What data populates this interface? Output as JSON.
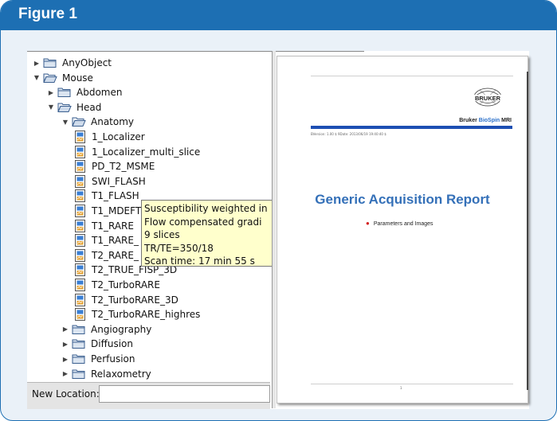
{
  "figure": {
    "title": "Figure 1",
    "accent_color": "#1d6fb3"
  },
  "tree": {
    "nodes": [
      {
        "label": "AnyObject",
        "kind": "folder",
        "expanded": false,
        "depth": 0
      },
      {
        "label": "Mouse",
        "kind": "folder",
        "expanded": true,
        "depth": 0
      },
      {
        "label": "Abdomen",
        "kind": "folder",
        "expanded": false,
        "depth": 1
      },
      {
        "label": "Head",
        "kind": "folder",
        "expanded": true,
        "depth": 1
      },
      {
        "label": "Anatomy",
        "kind": "folder",
        "expanded": true,
        "depth": 2
      },
      {
        "label": "1_Localizer",
        "kind": "file",
        "depth": 3
      },
      {
        "label": "1_Localizer_multi_slice",
        "kind": "file",
        "depth": 3
      },
      {
        "label": "PD_T2_MSME",
        "kind": "file",
        "depth": 3
      },
      {
        "label": "SWI_FLASH",
        "kind": "file",
        "depth": 3
      },
      {
        "label": "T1_FLASH",
        "kind": "file",
        "depth": 3
      },
      {
        "label": "T1_MDEFT",
        "kind": "file",
        "depth": 3
      },
      {
        "label": "T1_RARE",
        "kind": "file",
        "depth": 3
      },
      {
        "label": "T1_RARE_",
        "kind": "file",
        "depth": 3
      },
      {
        "label": "T2_RARE_",
        "kind": "file",
        "depth": 3
      },
      {
        "label": "T2_TRUE_FISP_3D",
        "kind": "file",
        "depth": 3
      },
      {
        "label": "T2_TurboRARE",
        "kind": "file",
        "depth": 3
      },
      {
        "label": "T2_TurboRARE_3D",
        "kind": "file",
        "depth": 3
      },
      {
        "label": "T2_TurboRARE_highres",
        "kind": "file",
        "depth": 3
      },
      {
        "label": "Angiography",
        "kind": "folder",
        "expanded": false,
        "depth": 2
      },
      {
        "label": "Diffusion",
        "kind": "folder",
        "expanded": false,
        "depth": 2
      },
      {
        "label": "Perfusion",
        "kind": "folder",
        "expanded": false,
        "depth": 2
      },
      {
        "label": "Relaxometry",
        "kind": "folder",
        "expanded": false,
        "depth": 2
      }
    ]
  },
  "tooltip": {
    "lines": [
      "Susceptibility weighted in",
      "Flow compensated gradi",
      "9 slices",
      "TR/TE=350/18",
      "Scan time: 17 min 55 s"
    ]
  },
  "new_location": {
    "label": "New Location:",
    "value": ""
  },
  "report": {
    "company_prefix": "Bruker ",
    "company_highlight": "BioSpin",
    "company_suffix": " MRI",
    "logo_text": "BRUKER",
    "version_line": "BVersion: 1.00 $ 9Date: 2013/06/19 19:40:40 $",
    "title": "Generic Acquisition Report",
    "bullet": "Parameters and Images",
    "page_number": "1",
    "title_color": "#3470b8",
    "bar_color": "#1d4fb3",
    "bullet_color": "#d32020"
  }
}
